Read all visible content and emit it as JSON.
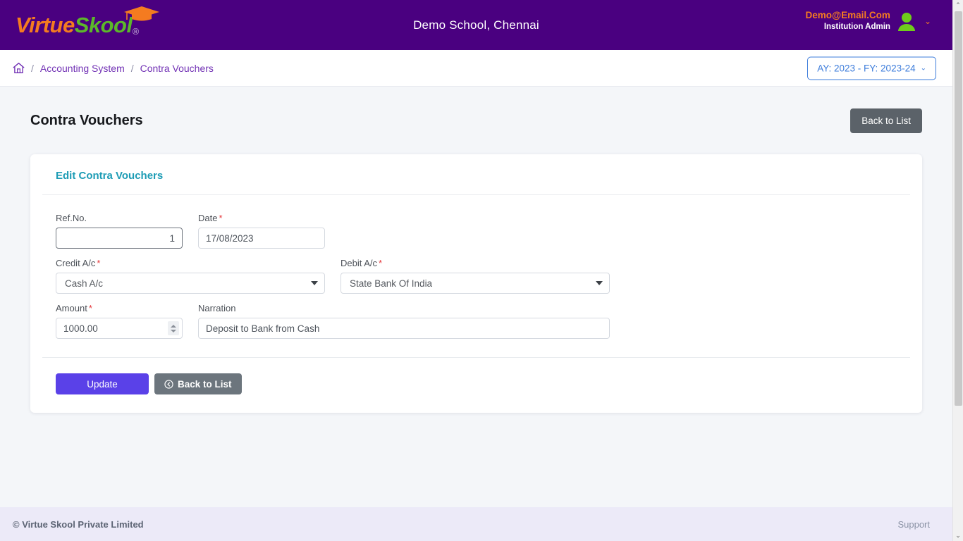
{
  "header": {
    "logo": {
      "part1": "Virtue",
      "part2": "Skool",
      "registered": "®",
      "cap_icon": "graduation-cap-icon",
      "color_part1": "#f47b20",
      "color_part2": "#5cb82a",
      "bar_color": "#4a0080"
    },
    "school_name": "Demo School, Chennai",
    "user": {
      "email": "Demo@Email.Com",
      "role": "Institution Admin",
      "avatar_icon": "user-avatar-icon",
      "caret": "⌄",
      "email_color": "#f47b20"
    }
  },
  "breadcrumb": {
    "home_icon": "home-icon",
    "separator": "/",
    "items": [
      {
        "label": "Accounting System"
      },
      {
        "label": "Contra Vouchers"
      }
    ],
    "link_color": "#7232b5"
  },
  "year_selector": {
    "label": "AY: 2023 - FY: 2023-24",
    "caret": "⌄",
    "accent": "#3e7ddb"
  },
  "page": {
    "title": "Contra Vouchers",
    "back_to_list_top": "Back to List"
  },
  "card": {
    "title": "Edit Contra Vouchers",
    "title_color": "#1d9cb5",
    "fields": {
      "ref_no": {
        "label": "Ref.No.",
        "value": "1",
        "required": false,
        "placeholder": ""
      },
      "date": {
        "label": "Date",
        "value": "17/08/2023",
        "required": true,
        "placeholder": ""
      },
      "credit_ac": {
        "label": "Credit A/c",
        "value": "Cash A/c",
        "required": true
      },
      "debit_ac": {
        "label": "Debit A/c",
        "value": "State Bank Of India",
        "required": true
      },
      "amount": {
        "label": "Amount",
        "value": "1000.00",
        "required": true,
        "stepper_icon": "spinner-updown-icon"
      },
      "narration": {
        "label": "Narration",
        "value": "Deposit to Bank from Cash",
        "required": false,
        "placeholder": ""
      }
    },
    "required_marker": "*",
    "actions": {
      "update": "Update",
      "back_to_list": "Back to List",
      "back_icon": "circle-arrow-left-icon",
      "update_color": "#5a41e8",
      "back_color": "#6c757d"
    }
  },
  "footer": {
    "copyright": "© Virtue Skool Private Limited",
    "support": "Support"
  },
  "scrollbar": {
    "up_arrow": "⌃",
    "down_arrow": "⌄"
  }
}
